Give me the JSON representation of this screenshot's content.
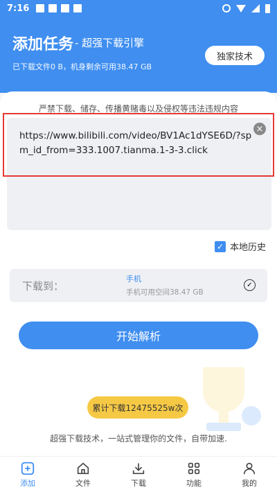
{
  "status_bar": {
    "time": "7:16"
  },
  "header": {
    "title": "添加任务",
    "subtitle": "- 超强下载引擎",
    "storage_info": "已下载文件0 B，机身剩余可用38.47 GB",
    "exclusive_button": "独家技术"
  },
  "main": {
    "warning": "严禁下载、储存、传播黄赌毒以及侵权等违法违规内容",
    "url_value": "https://www.bilibili.com/video/BV1Ac1dYSE6D/?spm_id_from=333.1007.tianma.1-3-3.click",
    "history_label": "本地历史",
    "download_to": {
      "label": "下载到：",
      "target": "手机",
      "space": "手机可用空间38.47 GB"
    },
    "parse_button": "开始解析",
    "total_downloads": "累计下载12475525w次",
    "tagline": "超强下载技术，一站式管理你的文件，自带加速."
  },
  "bottom_nav": [
    {
      "label": "添加",
      "icon": "add-icon",
      "active": true
    },
    {
      "label": "文件",
      "icon": "home-icon"
    },
    {
      "label": "下载",
      "icon": "download-icon"
    },
    {
      "label": "功能",
      "icon": "grid-icon"
    },
    {
      "label": "我的",
      "icon": "profile-icon"
    }
  ],
  "colors": {
    "primary": "#3f8ef0",
    "accent": "#f6c945",
    "highlight": "#e53935"
  }
}
